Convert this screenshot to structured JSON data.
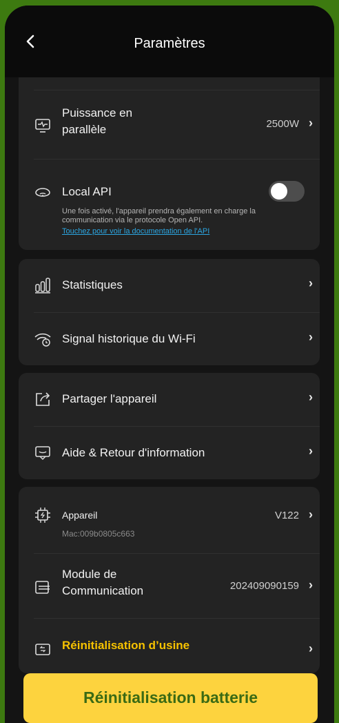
{
  "header": {
    "back_icon": "chevron-left-icon",
    "title": "Paramètres"
  },
  "power_card": {
    "parallel": {
      "label_line1": "Puissance en",
      "label_line2": "parallèle",
      "value": "2500W",
      "icon": "monitor-pulse-icon"
    },
    "local_api": {
      "label": "Local API",
      "icon": "cloud-wifi-icon",
      "enabled": false,
      "description": "Une fois activé, l'appareil prendra également en charge la communication via le protocole Open API.",
      "link": "Touchez pour voir la documentation de l'API"
    }
  },
  "stats_card": {
    "statistics": {
      "label": "Statistiques",
      "icon": "bar-chart-icon"
    },
    "wifi_history": {
      "label": "Signal historique du Wi-Fi",
      "icon": "wifi-history-icon"
    }
  },
  "share_card": {
    "share": {
      "label": "Partager l'appareil",
      "icon": "share-icon"
    },
    "help": {
      "label": "Aide & Retour d'information",
      "icon": "feedback-icon"
    }
  },
  "device_card": {
    "device": {
      "label": "Appareil",
      "mac": "Mac:009b0805c663",
      "value": "V122",
      "icon": "chip-icon"
    },
    "module": {
      "label_line1": "Module de",
      "label_line2": "Communication",
      "value": "202409090159",
      "icon": "module-icon"
    },
    "factory_reset": {
      "label": "Réinitialisation d’usine",
      "icon": "reset-icon"
    }
  },
  "overlay_badge": {
    "text": "Réinitialisation batterie"
  },
  "chevron": "›"
}
